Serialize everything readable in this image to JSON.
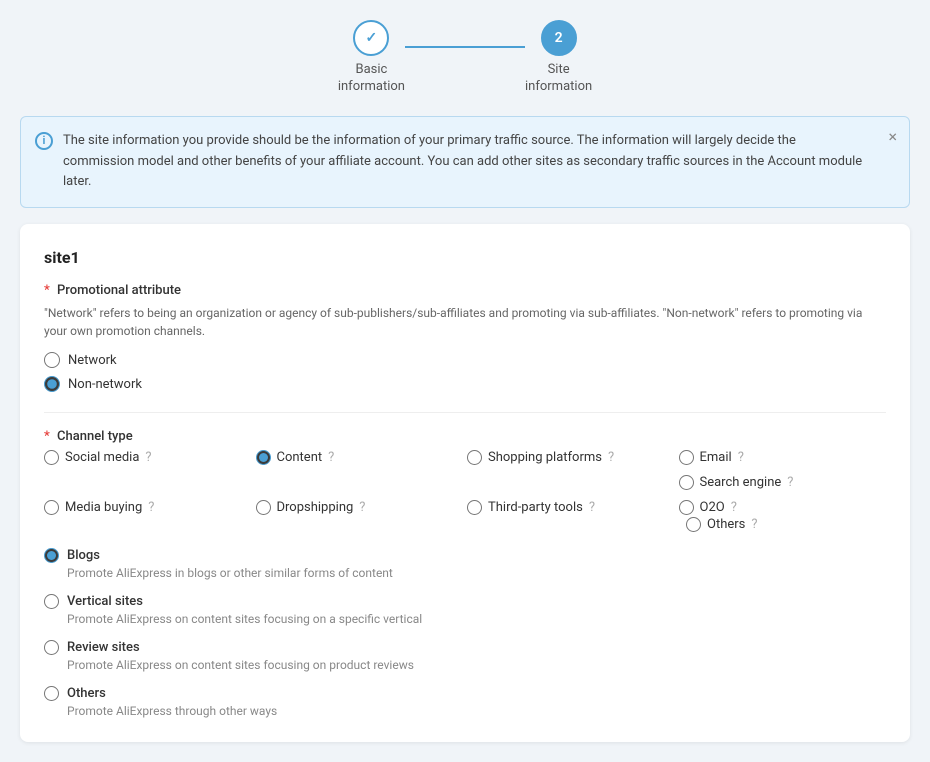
{
  "stepper": {
    "steps": [
      {
        "id": "basic",
        "label_line1": "Basic",
        "label_line2": "information",
        "state": "completed",
        "number": "✓"
      },
      {
        "id": "site",
        "label_line1": "Site",
        "label_line2": "information",
        "state": "active",
        "number": "2"
      }
    ]
  },
  "banner": {
    "text": "The site information you provide should be the information of your primary traffic source. The information will largely decide the commission model and other benefits of your affiliate account. You can add other sites as secondary traffic sources in the Account module later.",
    "close_label": "×"
  },
  "card": {
    "site_title": "site1",
    "promo_label": "Promotional attribute",
    "promo_desc": "\"Network\" refers to being an organization or agency of sub-publishers/sub-affiliates and promoting via sub-affiliates. \"Non-network\" refers to promoting via your own promotion channels.",
    "promo_options": [
      {
        "id": "network",
        "label": "Network",
        "checked": false
      },
      {
        "id": "non-network",
        "label": "Non-network",
        "checked": true
      }
    ],
    "channel_label": "Channel type",
    "channels": [
      {
        "id": "social_media",
        "label": "Social media",
        "checked": false
      },
      {
        "id": "content",
        "label": "Content",
        "checked": true
      },
      {
        "id": "shopping",
        "label": "Shopping platforms",
        "checked": false
      },
      {
        "id": "email",
        "label": "Email",
        "checked": false
      },
      {
        "id": "search_engine",
        "label": "Search engine",
        "checked": false
      },
      {
        "id": "media_buying",
        "label": "Media buying",
        "checked": false
      },
      {
        "id": "dropshipping",
        "label": "Dropshipping",
        "checked": false
      },
      {
        "id": "third_party",
        "label": "Third-party tools",
        "checked": false
      },
      {
        "id": "o2o",
        "label": "O2O",
        "checked": false
      },
      {
        "id": "others",
        "label": "Others",
        "checked": false
      }
    ],
    "content_sub_options": [
      {
        "id": "blogs",
        "label": "Blogs",
        "desc": "Promote AliExpress in blogs or other similar forms of content",
        "checked": true
      },
      {
        "id": "vertical_sites",
        "label": "Vertical sites",
        "desc": "Promote AliExpress on content sites focusing on a specific vertical",
        "checked": false
      },
      {
        "id": "review_sites",
        "label": "Review sites",
        "desc": "Promote AliExpress on content sites focusing on product reviews",
        "checked": false
      },
      {
        "id": "others_sub",
        "label": "Others",
        "desc": "Promote AliExpress through other ways",
        "checked": false
      }
    ]
  },
  "icons": {
    "info": "i",
    "close": "×",
    "check": "✓",
    "help": "?"
  }
}
